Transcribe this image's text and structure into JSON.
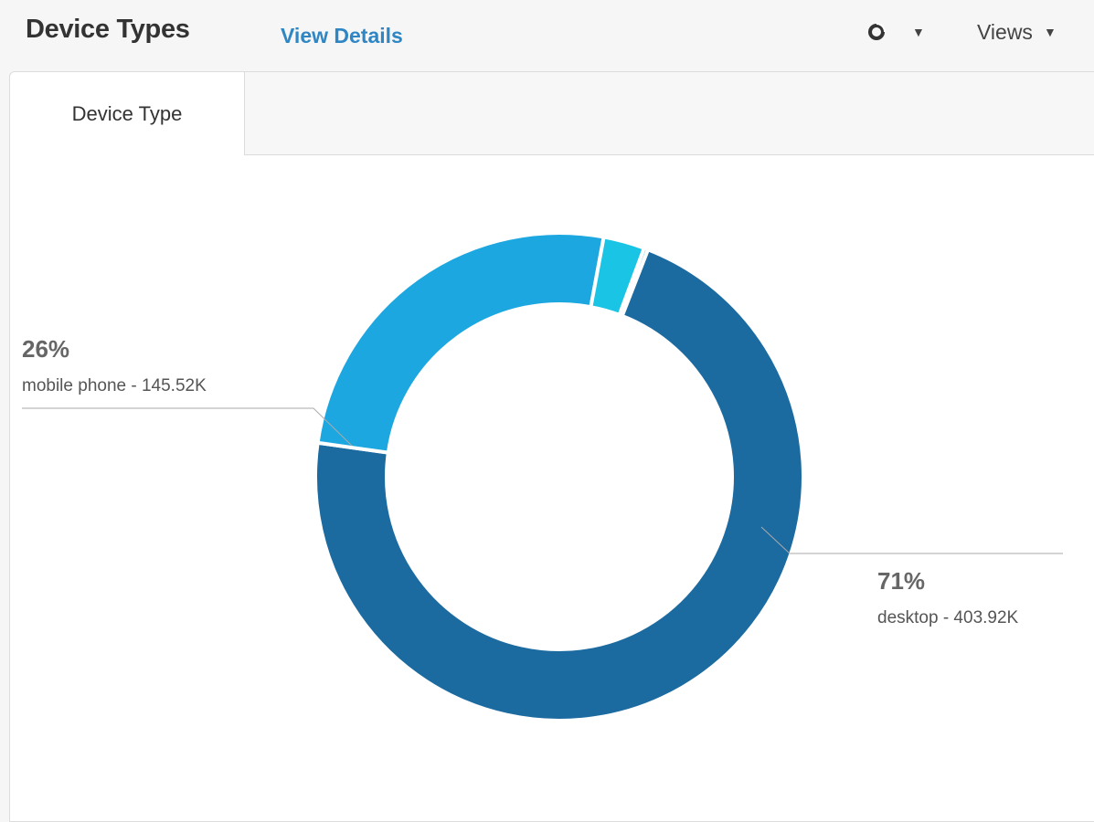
{
  "header": {
    "title": "Device Types",
    "view_details": "View Details",
    "chart_type_icon": "donut-chart-icon",
    "views_label": "Views",
    "caret": "▼"
  },
  "tabs": [
    {
      "label": "Device Type",
      "active": true
    }
  ],
  "colors": {
    "desktop": "#1b6aa0",
    "mobile_phone": "#1da7e0",
    "third": "#19c4e4",
    "fourth": "#3fd3cf",
    "link": "#2f86c4"
  },
  "chart_data": {
    "type": "pie",
    "style": "donut",
    "series": [
      {
        "name": "desktop",
        "value": 403.92,
        "value_label": "403.92K",
        "percent_label": "71%"
      },
      {
        "name": "mobile phone",
        "value": 145.52,
        "value_label": "145.52K",
        "percent_label": "26%"
      },
      {
        "name": "",
        "value": 15.5
      },
      {
        "name": "",
        "value": 1.5
      }
    ],
    "labels": {
      "desktop": {
        "percent": "71%",
        "text": "desktop - 403.92K"
      },
      "mobile_phone": {
        "percent": "26%",
        "text": "mobile phone - 145.52K"
      }
    }
  }
}
